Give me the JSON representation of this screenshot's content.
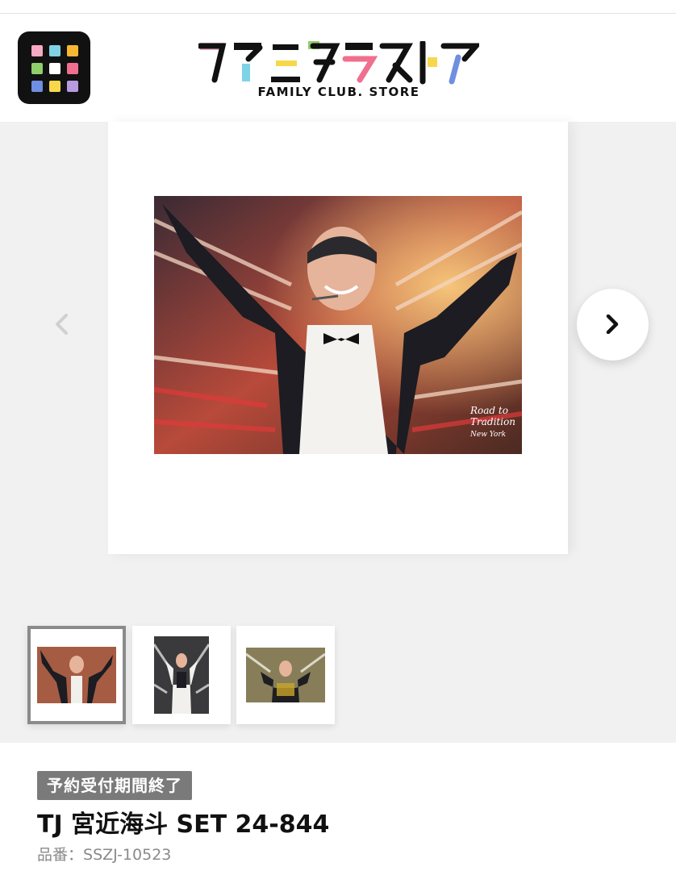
{
  "header": {
    "logo_text": "ファミクラストア",
    "logo_subtitle": "FAMILY CLUB. STORE",
    "app_icon_colors": [
      "#f5a9c3",
      "#7fd3e6",
      "#f7b733",
      "#8fcf6a",
      "#ffffff",
      "#f06f8e",
      "#6f8fe0",
      "#f7d84a",
      "#b79ae0"
    ]
  },
  "gallery": {
    "main_photo_caption": "Road to Tradition New York",
    "prev_icon": "chevron-left-icon",
    "next_icon": "chevron-right-icon",
    "thumbnails": [
      {
        "label": "photo-1",
        "active": true
      },
      {
        "label": "photo-2",
        "active": false
      },
      {
        "label": "photo-3",
        "active": false
      }
    ]
  },
  "product": {
    "status_badge": "予約受付期間終了",
    "title": "TJ 宮近海斗 SET 24-844",
    "sku_label": "品番：",
    "sku_value": "SSZJ-10523"
  }
}
